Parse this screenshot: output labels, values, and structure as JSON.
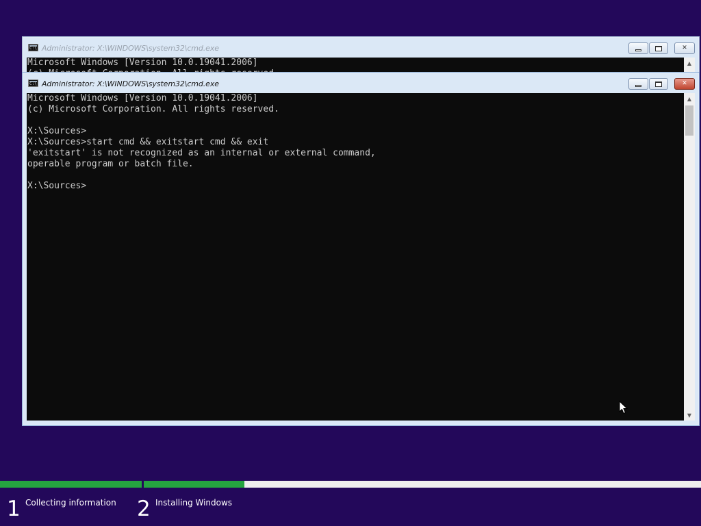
{
  "background_window": {
    "title": "Administrator: X:\\WINDOWS\\system32\\cmd.exe",
    "lines": [
      "Microsoft Windows [Version 10.0.19041.2006]",
      "(c) Microsoft Corporation. All rights reserved."
    ]
  },
  "foreground_window": {
    "title": "Administrator: X:\\WINDOWS\\system32\\cmd.exe",
    "lines": [
      "Microsoft Windows [Version 10.0.19041.2006]",
      "(c) Microsoft Corporation. All rights reserved.",
      "",
      "X:\\Sources>",
      "X:\\Sources>start cmd && exitstart cmd && exit",
      "'exitstart' is not recognized as an internal or external command,",
      "operable program or batch file.",
      "",
      "X:\\Sources>"
    ]
  },
  "icons": {
    "app": "cmd-console-icon",
    "minimize": "minimize-icon",
    "maximize": "maximize-icon",
    "close": "close-icon",
    "scroll_up": "chevron-up-icon",
    "scroll_down": "chevron-down-icon",
    "pointer": "mouse-pointer-icon"
  },
  "setup_progress": {
    "steps": [
      {
        "number": "1",
        "label": "Collecting information",
        "progress": 1.0
      },
      {
        "number": "2",
        "label": "Installing Windows",
        "progress": 0.18
      }
    ],
    "colors": {
      "fill": "#25a440",
      "track": "#eeeeee",
      "background": "#23085a"
    }
  }
}
